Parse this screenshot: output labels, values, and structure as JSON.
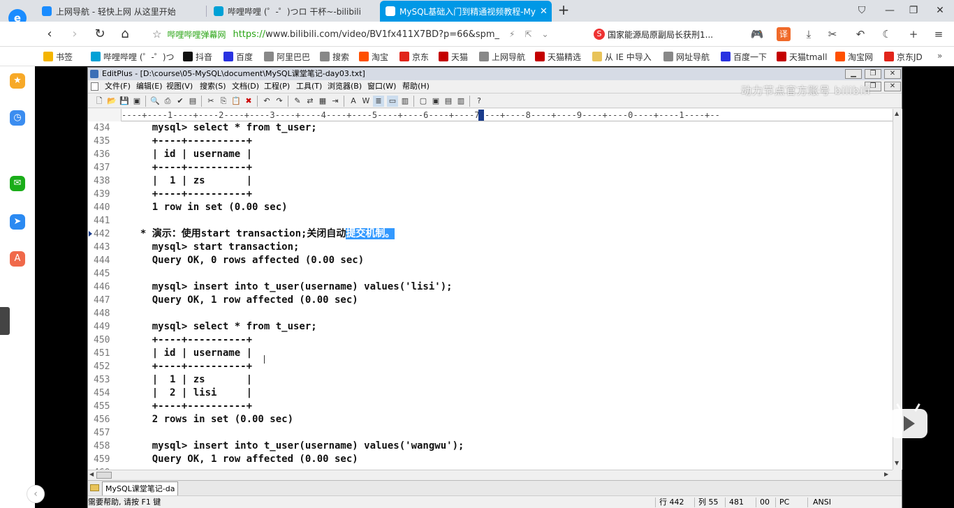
{
  "browser": {
    "tabs": [
      {
        "label": "上网导航 - 轻快上网 从这里开始",
        "active": false,
        "color": "#1a8cff"
      },
      {
        "label": "哔哩哔哩 (゜-゜)つロ 干杯~-bilibili",
        "active": false,
        "color": "#00a1d6"
      },
      {
        "label": "MySQL基础入门到精通视频教程-My",
        "active": true,
        "color": "#00a1d6"
      }
    ],
    "tab_close": "✕",
    "new_tab": "+",
    "window_controls": [
      "⛉",
      "—",
      "❐",
      "✕"
    ]
  },
  "address_bar": {
    "site_name": "哔哩哔哩弹幕网",
    "url_https": "https://",
    "url_rest": "www.bilibili.com/video/BV1fx411X7BD?p=66&spm_",
    "news_text": "国家能源局原副局长获刑1..."
  },
  "bookmarks": [
    {
      "label": "书签",
      "color": "#f4b400"
    },
    {
      "label": "哔哩哔哩 (゜-゜)つ",
      "color": "#00a1d6"
    },
    {
      "label": "抖音",
      "color": "#111111"
    },
    {
      "label": "百度",
      "color": "#2932e1"
    },
    {
      "label": "阿里巴巴",
      "color": "#888888"
    },
    {
      "label": "搜索",
      "color": "#888888"
    },
    {
      "label": "淘宝",
      "color": "#ff5000"
    },
    {
      "label": "京东",
      "color": "#e1251b"
    },
    {
      "label": "天猫",
      "color": "#c40000"
    },
    {
      "label": "上网导航",
      "color": "#888888"
    },
    {
      "label": "天猫精选",
      "color": "#c40000"
    },
    {
      "label": "从 IE 中导入",
      "color": "#e8c35a"
    },
    {
      "label": "网址导航",
      "color": "#888888"
    },
    {
      "label": "百度一下",
      "color": "#2932e1"
    },
    {
      "label": "天猫tmall",
      "color": "#c40000"
    },
    {
      "label": "淘宝网",
      "color": "#ff5000"
    },
    {
      "label": "京东JD",
      "color": "#e1251b"
    }
  ],
  "bookmarks_more": "»",
  "sidebar_colors": [
    "#f7a928",
    "#3b8df0",
    "#1aad19",
    "#2b8af2",
    "#f0694a"
  ],
  "editor": {
    "title": "EditPlus - [D:\\course\\05-MySQL\\document\\MySQL课堂笔记-day03.txt]",
    "menu": [
      "文件(F)",
      "编辑(E)",
      "视图(V)",
      "搜索(S)",
      "文档(D)",
      "工程(P)",
      "工具(T)",
      "浏览器(B)",
      "窗口(W)",
      "帮助(H)"
    ],
    "watermark": "动力节点官方账号 bilibili",
    "ruler": "----+----1----+----2----+----3----+----4----+----5----+----6----+----7----+----8----+----9----+----0----+----1----+--",
    "lines": [
      {
        "n": "434",
        "t": "    mysql> select * from t_user;"
      },
      {
        "n": "435",
        "t": "    +----+----------+"
      },
      {
        "n": "436",
        "t": "    | id | username |"
      },
      {
        "n": "437",
        "t": "    +----+----------+"
      },
      {
        "n": "438",
        "t": "    |  1 | zs       |"
      },
      {
        "n": "439",
        "t": "    +----+----------+"
      },
      {
        "n": "440",
        "t": "    1 row in set (0.00 sec)"
      },
      {
        "n": "441",
        "t": ""
      },
      {
        "n": "442",
        "t": "  * 演示：使用start transaction;关闭自动",
        "sel": "提交机制。"
      },
      {
        "n": "443",
        "t": "    mysql> start transaction;"
      },
      {
        "n": "444",
        "t": "    Query OK, 0 rows affected (0.00 sec)"
      },
      {
        "n": "445",
        "t": ""
      },
      {
        "n": "446",
        "t": "    mysql> insert into t_user(username) values('lisi');"
      },
      {
        "n": "447",
        "t": "    Query OK, 1 row affected (0.00 sec)"
      },
      {
        "n": "448",
        "t": ""
      },
      {
        "n": "449",
        "t": "    mysql> select * from t_user;"
      },
      {
        "n": "450",
        "t": "    +----+----------+"
      },
      {
        "n": "451",
        "t": "    | id | username |"
      },
      {
        "n": "452",
        "t": "    +----+----------+"
      },
      {
        "n": "453",
        "t": "    |  1 | zs       |"
      },
      {
        "n": "454",
        "t": "    |  2 | lisi     |"
      },
      {
        "n": "455",
        "t": "    +----+----------+"
      },
      {
        "n": "456",
        "t": "    2 rows in set (0.00 sec)"
      },
      {
        "n": "457",
        "t": ""
      },
      {
        "n": "458",
        "t": "    mysql> insert into t_user(username) values('wangwu');"
      },
      {
        "n": "459",
        "t": "    Query OK, 1 row affected (0.00 sec)"
      },
      {
        "n": "460",
        "t": ""
      }
    ],
    "doc_tab": "MySQL课堂笔记-da",
    "status": {
      "help": "需要帮助, 请按 F1 键",
      "line": "行 442",
      "col": "列 55",
      "total": "481",
      "n00": "00",
      "mode": "PC",
      "encoding": "ANSI"
    }
  }
}
